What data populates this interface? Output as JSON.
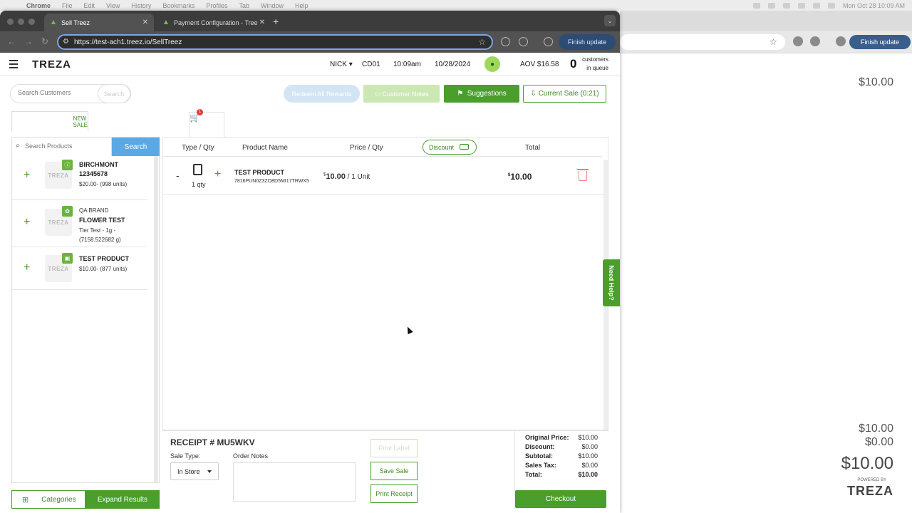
{
  "menubar": {
    "app": "Chrome",
    "items": [
      "File",
      "Edit",
      "View",
      "History",
      "Bookmarks",
      "Profiles",
      "Tab",
      "Window",
      "Help"
    ],
    "clock": "Mon Oct 28  10:09 AM"
  },
  "browser": {
    "tabs": [
      {
        "label": "Sell Treez"
      },
      {
        "label": "Payment Configuration - Tree"
      }
    ],
    "url": "https://test-ach1.treez.io/SellTreez",
    "finish_update": "Finish update"
  },
  "bg_window": {
    "finish_update": "Finish update",
    "price_top": "$10.00",
    "subtotal": "$10.00",
    "discount": "$0.00",
    "total": "$10.00",
    "powered_by": "POWERED BY",
    "logo": "TREZA"
  },
  "header": {
    "logo": "TREZA",
    "user": "NICK",
    "register": "CD01",
    "time": "10:09am",
    "date": "10/28/2024",
    "aov": "AOV $16.58",
    "queue_count": "0",
    "queue_label_1": "customers",
    "queue_label_2": "in queue"
  },
  "actions": {
    "search_customers_placeholder": "Search Customers",
    "search_button": "Search",
    "redeem": "Redeem All Rewards",
    "customer_notes": "Customer Notes",
    "suggestions": "Suggestions",
    "current_sale": "Current Sale (0:21)"
  },
  "sale_tab": {
    "label": "NEW SALE",
    "badge": "1"
  },
  "products": {
    "search_placeholder": "Search Products",
    "search_button": "Search",
    "items": [
      {
        "brand": "",
        "name": "BIRCHMONT 12345678",
        "meta": "$20.00- (998 units)",
        "thumb": "TREZA",
        "badge_icon": "bolt-icon"
      },
      {
        "brand": "QA BRAND",
        "name": "FLOWER TEST",
        "meta": "Tier Test - 1g - (7158.522682 g)",
        "thumb": "TREZA",
        "badge_icon": "leaf-icon"
      },
      {
        "brand": "",
        "name": "TEST PRODUCT",
        "meta": "$10.00- (877 units)",
        "thumb": "TREZA",
        "badge_icon": "package-icon"
      }
    ],
    "categories": "Categories",
    "expand": "Expand Results"
  },
  "cart": {
    "headers": {
      "type_qty": "Type / Qty",
      "product_name": "Product Name",
      "price_qty": "Price / Qty",
      "discount": "Discount",
      "total": "Total"
    },
    "rows": [
      {
        "minus": "-",
        "qty": "1 qty",
        "plus": "+",
        "name": "TEST PRODUCT",
        "sku": "7816PUN0Z3ZO8D5MI17TRWX5",
        "price_currency": "$",
        "price": "10.00",
        "unit": " / 1 Unit",
        "total_currency": "$",
        "total": "10.00"
      }
    ]
  },
  "receipt": {
    "number": "RECEIPT # MU5WKV",
    "sale_type_label": "Sale Type:",
    "sale_type_value": "In Store",
    "order_notes_label": "Order Notes",
    "print_label": "Print Label",
    "save_sale": "Save Sale",
    "print_receipt": "Print Receipt"
  },
  "summary": {
    "original_price_label": "Original Price:",
    "original_price": "$10.00",
    "discount_label": "Discount:",
    "discount": "$0.00",
    "subtotal_label": "Subtotal:",
    "subtotal": "$10.00",
    "sales_tax_label": "Sales Tax:",
    "sales_tax": "$0.00",
    "total_label": "Total:",
    "total": "$10.00",
    "checkout": "Checkout"
  },
  "need_help": "Need Help?",
  "colors": {
    "brand_green": "#4a9e2c",
    "search_blue": "#5aa9e6"
  }
}
